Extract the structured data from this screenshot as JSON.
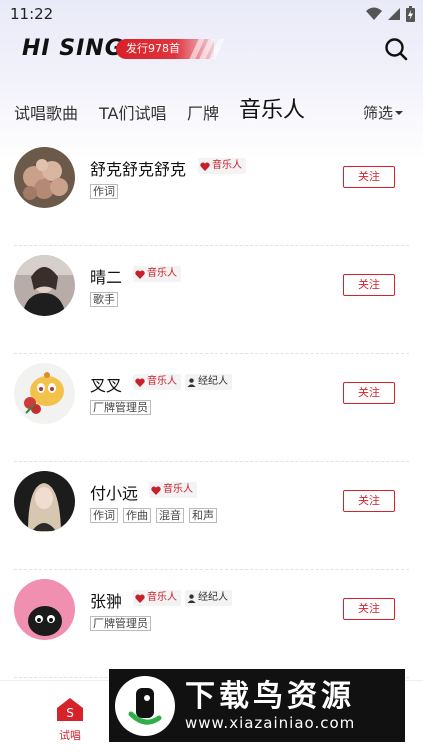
{
  "status_bar": {
    "time": "11:22",
    "icons": [
      "wifi-icon",
      "signal-icon",
      "battery-icon"
    ]
  },
  "header": {
    "logo": "HI SING",
    "release_badge": "发行978首",
    "search_icon": "search-icon"
  },
  "tabs": [
    {
      "label": "试唱歌曲",
      "active": false
    },
    {
      "label": "TA们试唱",
      "active": false
    },
    {
      "label": "厂牌",
      "active": false
    },
    {
      "label": "音乐人",
      "active": true
    }
  ],
  "filter": {
    "label": "筛选"
  },
  "musicians": [
    {
      "name": "舒克舒克舒克",
      "badges": [
        {
          "type": "musician",
          "label": "音乐人"
        }
      ],
      "roles": [
        "作词"
      ],
      "follow": "关注"
    },
    {
      "name": "晴二",
      "badges": [
        {
          "type": "musician",
          "label": "音乐人"
        }
      ],
      "roles": [
        "歌手"
      ],
      "follow": "关注"
    },
    {
      "name": "叉叉",
      "badges": [
        {
          "type": "musician",
          "label": "音乐人"
        },
        {
          "type": "agent",
          "label": "经纪人"
        }
      ],
      "roles": [
        "厂牌管理员"
      ],
      "follow": "关注"
    },
    {
      "name": "付小远",
      "badges": [
        {
          "type": "musician",
          "label": "音乐人"
        }
      ],
      "roles": [
        "作词",
        "作曲",
        "混音",
        "和声"
      ],
      "follow": "关注"
    },
    {
      "name": "张翀",
      "badges": [
        {
          "type": "musician",
          "label": "音乐人"
        },
        {
          "type": "agent",
          "label": "经纪人"
        }
      ],
      "roles": [
        "厂牌管理员"
      ],
      "follow": "关注"
    }
  ],
  "bottom_nav": {
    "home_label": "试唱",
    "home_icon_letter": "S"
  },
  "watermark": {
    "title": "下载鸟资源",
    "url": "www.xiazainiao.com"
  },
  "colors": {
    "accent": "#d6222b",
    "tab_underline": "#d6222b"
  }
}
